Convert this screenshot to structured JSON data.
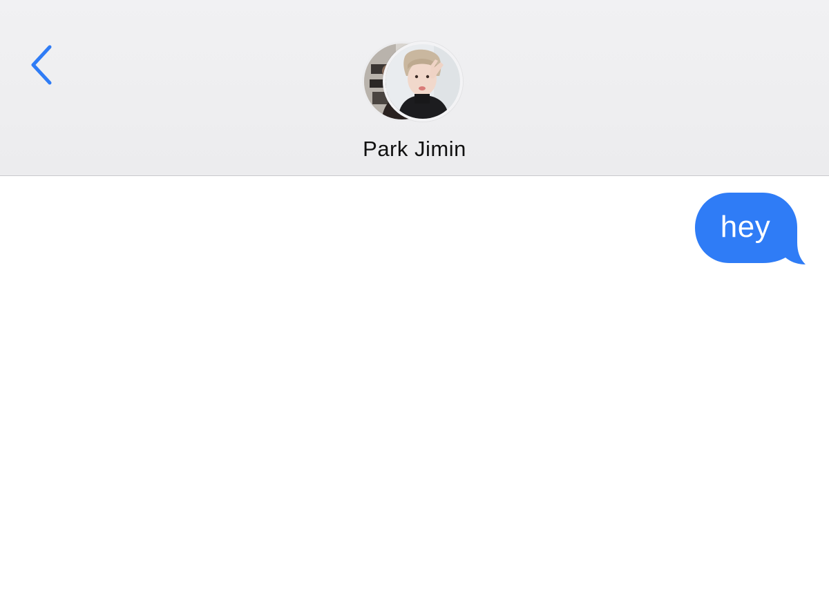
{
  "header": {
    "contact_name": "Park Jimin",
    "back_icon": "chevron-left-icon",
    "accent_color": "#2f7cf6"
  },
  "avatars": [
    {
      "name": "avatar-secondary"
    },
    {
      "name": "avatar-primary"
    }
  ],
  "messages": [
    {
      "direction": "outgoing",
      "text": "hey",
      "bubble_color": "#2f7cf6"
    }
  ]
}
